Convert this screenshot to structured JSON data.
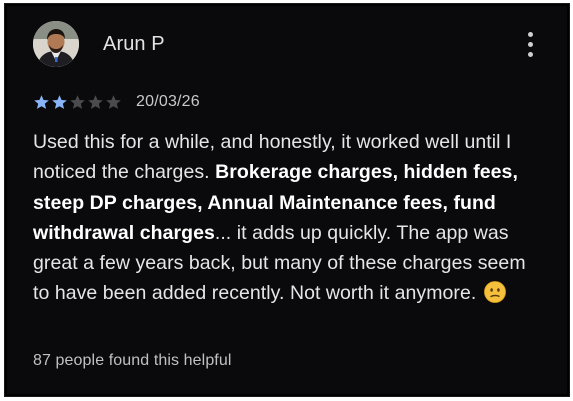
{
  "review": {
    "author": "Arun P",
    "rating": 2,
    "max_rating": 5,
    "date": "20/03/26",
    "text_part1": "Used this for a while, and honestly, it worked well until I noticed the charges. ",
    "text_bold": "Brokerage charges, hidden fees, steep DP charges, Annual Maintenance fees, fund withdrawal charges",
    "text_part2": "... it adds up quickly. The app was great a few years back, but many of these charges seem to have been added recently. Not worth it anymore. ",
    "emoji_icon": "confused-face-icon",
    "helpful_text": "87 people found this helpful"
  },
  "icons": {
    "avatar": "avatar",
    "menu": "more-vert-icon",
    "star_filled": "star-filled-icon",
    "star_empty": "star-empty-icon"
  },
  "colors": {
    "background": "#0a0a0c",
    "star_filled": "#8ab4f8",
    "star_empty": "#4a4a4f",
    "text": "#e6e6e6",
    "emoji": "#f5c13d"
  }
}
